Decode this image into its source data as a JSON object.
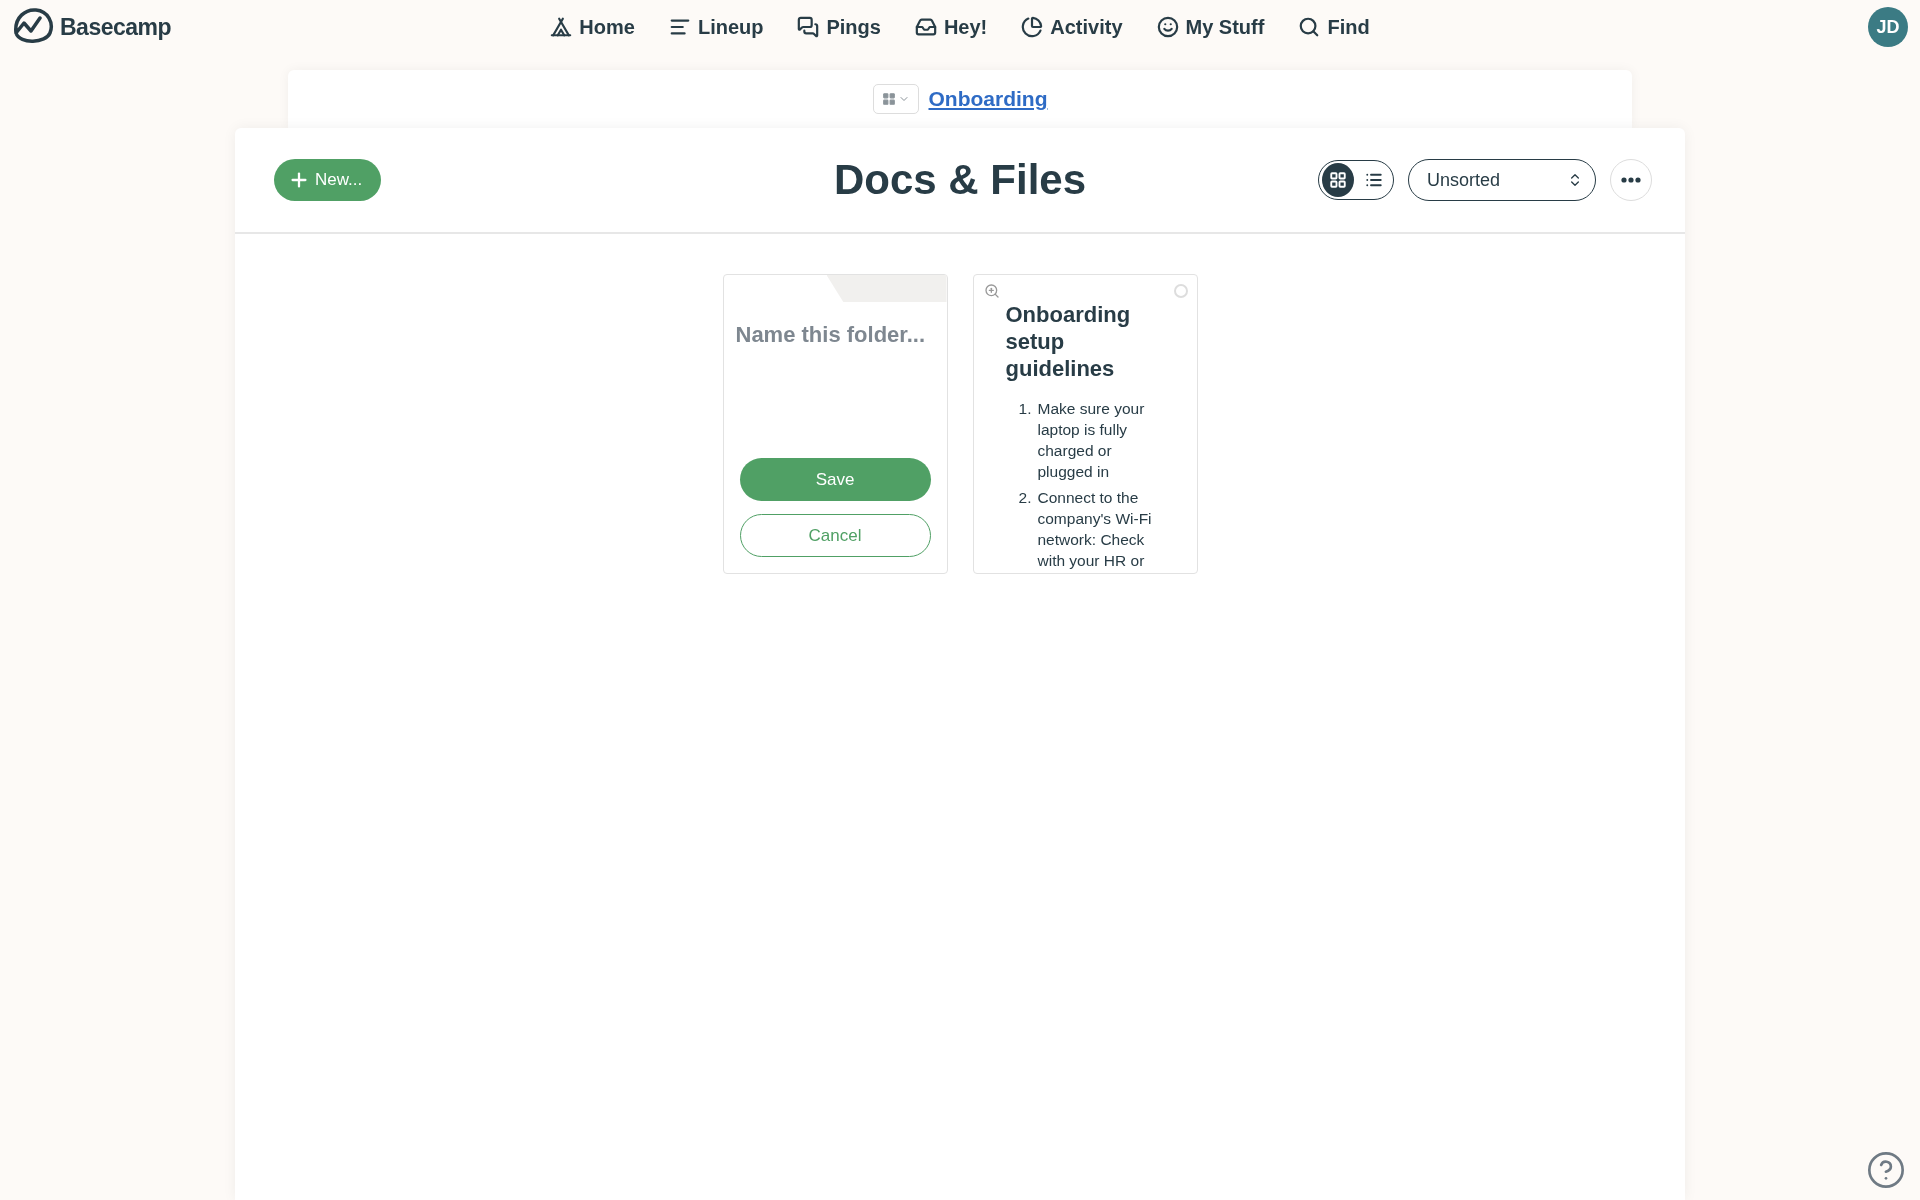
{
  "brand": {
    "name": "Basecamp"
  },
  "nav": [
    {
      "label": "Home"
    },
    {
      "label": "Lineup"
    },
    {
      "label": "Pings"
    },
    {
      "label": "Hey!"
    },
    {
      "label": "Activity"
    },
    {
      "label": "My Stuff"
    },
    {
      "label": "Find"
    }
  ],
  "avatar": {
    "initials": "JD"
  },
  "breadcrumb": {
    "project": "Onboarding"
  },
  "toolbar": {
    "new_button": "New...",
    "title": "Docs & Files",
    "view_modes": [
      {
        "kind": "grid",
        "selected": true
      },
      {
        "kind": "list",
        "selected": false
      }
    ],
    "sort": {
      "value": "Unsorted"
    }
  },
  "new_folder": {
    "placeholder": "Name this folder...",
    "save": "Save",
    "cancel": "Cancel"
  },
  "documents": [
    {
      "title": "Onboarding setup guidelines",
      "items": [
        {
          "marker": "1.",
          "text": "Make sure your laptop is fully charged or plugged in"
        },
        {
          "marker": "2.",
          "text": "Connect to the company's Wi-Fi network: Check with your HR or"
        }
      ]
    }
  ]
}
